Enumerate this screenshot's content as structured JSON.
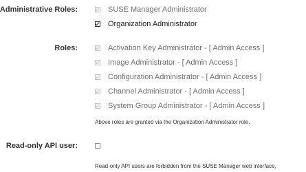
{
  "admin_roles": {
    "label": "Administrative Roles:",
    "options": [
      {
        "text": "SUSE Manager Administrator",
        "checked": false,
        "disabled": true
      },
      {
        "text": "Organization Administrator",
        "checked": true,
        "disabled": false
      }
    ]
  },
  "roles": {
    "label": "Roles:",
    "options": [
      {
        "text": "Activation Key Administrator - [ Admin Access ]",
        "checked": true,
        "disabled": true
      },
      {
        "text": "Image Administrator - [ Admin Access ]",
        "checked": true,
        "disabled": true
      },
      {
        "text": "Configuration Administrator - [ Admin Access ]",
        "checked": true,
        "disabled": true
      },
      {
        "text": "Channel Administrator - [ Admin Access ]",
        "checked": true,
        "disabled": true
      },
      {
        "text": "System Group Administrator - [ Admin Access ]",
        "checked": true,
        "disabled": true
      }
    ],
    "help": "Above roles are granted via the Organization Administrator role."
  },
  "readonly_api": {
    "label": "Read-only API user:",
    "checked": false,
    "help": "Read-only API users are forbidden from the SUSE Manager web interface,"
  }
}
